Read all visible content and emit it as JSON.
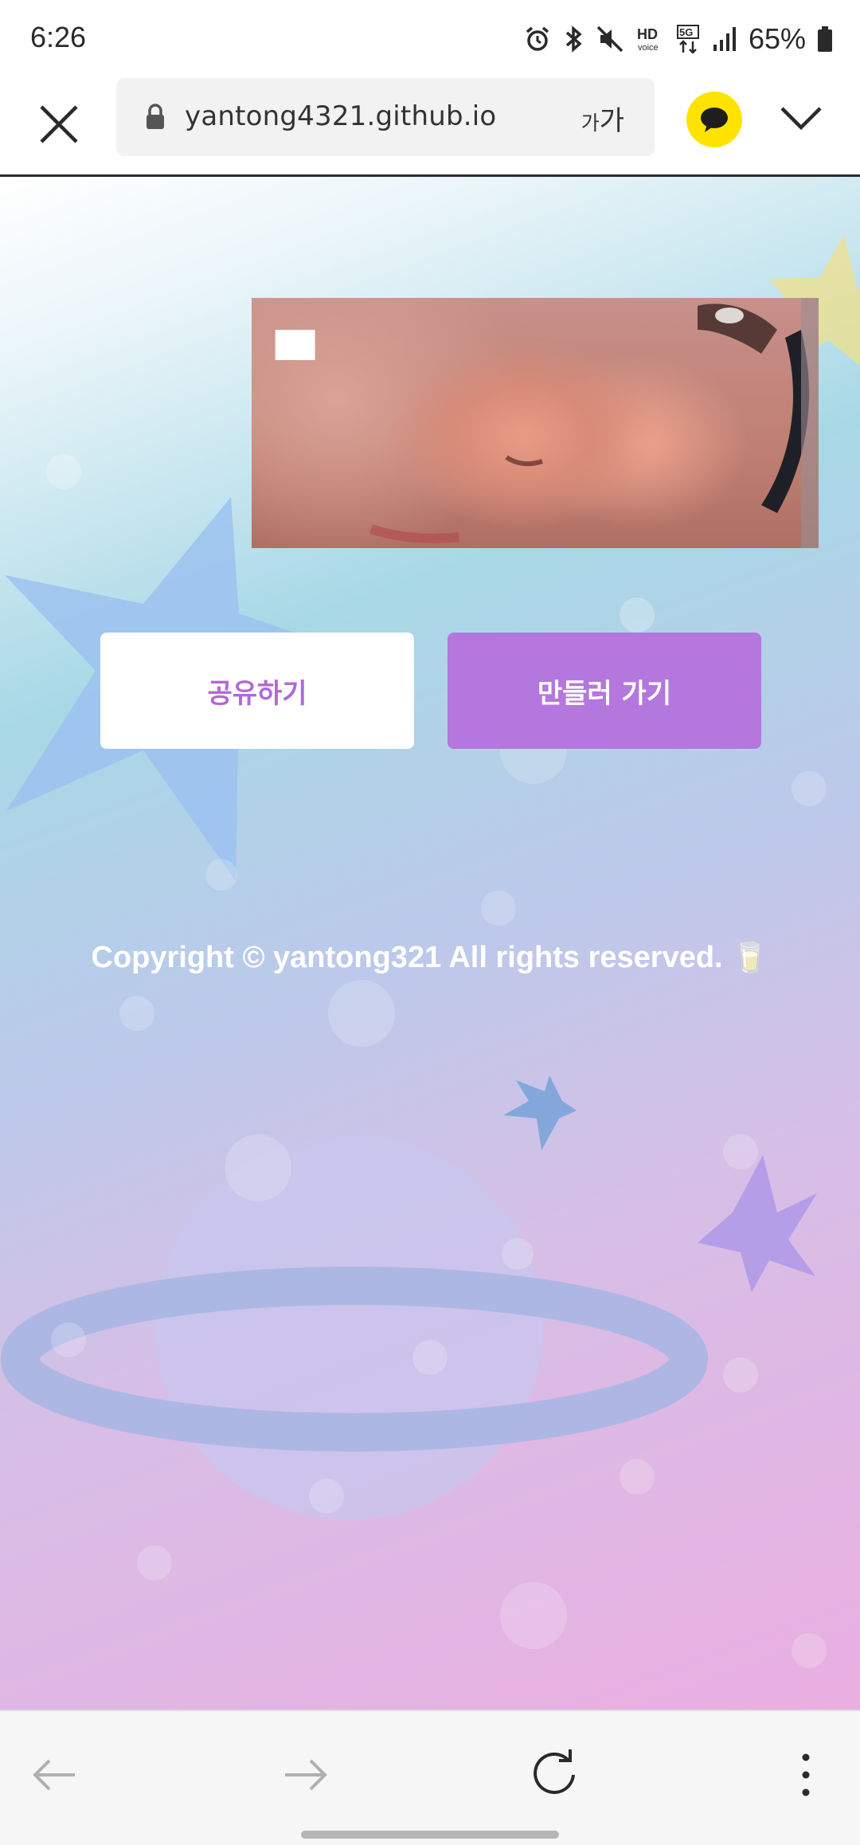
{
  "status_bar": {
    "time": "6:26",
    "battery": "65%",
    "icons": [
      "alarm-icon",
      "bluetooth-icon",
      "mute-icon",
      "hd-voice-icon",
      "5g-icon",
      "signal-icon",
      "battery-icon"
    ]
  },
  "browser": {
    "url": "yantong4321.github.io",
    "font_size_small": "가",
    "font_size_large": "가",
    "icons": [
      "close-icon",
      "lock-icon",
      "kakao-talk-icon",
      "chevron-down-icon"
    ]
  },
  "content": {
    "image_label": "██",
    "share_button": "공유하기",
    "make_button": "만들러 가기",
    "copyright": "Copyright © yantong321 All rights reserved. 🥛"
  },
  "bottom_nav": {
    "icons": [
      "back-arrow-icon",
      "forward-arrow-icon",
      "refresh-icon",
      "more-options-icon"
    ]
  },
  "colors": {
    "accent_purple": "#b477dd",
    "share_text": "#b06ad6",
    "kakao_yellow": "#ffe300"
  }
}
